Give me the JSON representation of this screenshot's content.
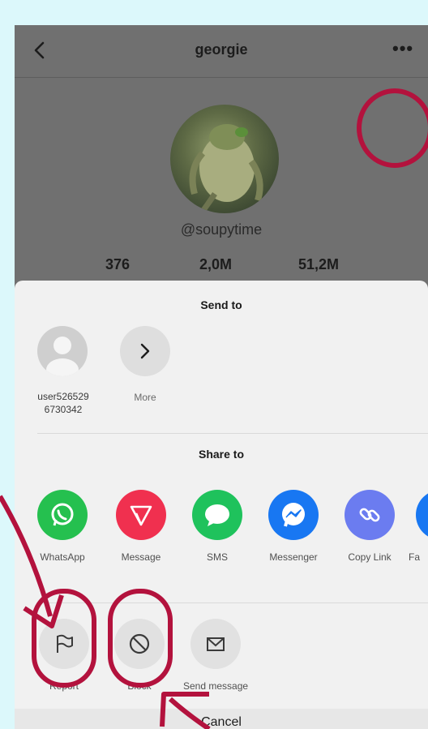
{
  "header": {
    "title": "georgie"
  },
  "profile": {
    "handle": "@soupytime",
    "stats": [
      "376",
      "2,0M",
      "51,2M"
    ]
  },
  "send_to": {
    "heading": "Send to",
    "contact_name": "user526529\n6730342",
    "more_label": "More"
  },
  "share_to": {
    "heading": "Share to",
    "items": [
      {
        "label": "WhatsApp",
        "icon": "whatsapp-icon",
        "color": "#25c04f"
      },
      {
        "label": "Message",
        "icon": "paper-plane-icon",
        "color": "#f0304f"
      },
      {
        "label": "SMS",
        "icon": "speech-bubble-icon",
        "color": "#1fc25c"
      },
      {
        "label": "Messenger",
        "icon": "messenger-icon",
        "color": "#1877f2"
      },
      {
        "label": "Copy Link",
        "icon": "link-icon",
        "color": "#6b7cf0"
      },
      {
        "label": "Fa",
        "icon": "facebook-icon",
        "color": "#1877f2"
      }
    ]
  },
  "actions": {
    "items": [
      {
        "label": "Report",
        "icon": "flag-icon"
      },
      {
        "label": "Block",
        "icon": "block-icon"
      },
      {
        "label": "Send message",
        "icon": "envelope-icon"
      }
    ]
  },
  "cancel_label": "Cancel",
  "annotation_color": "#b3123d"
}
